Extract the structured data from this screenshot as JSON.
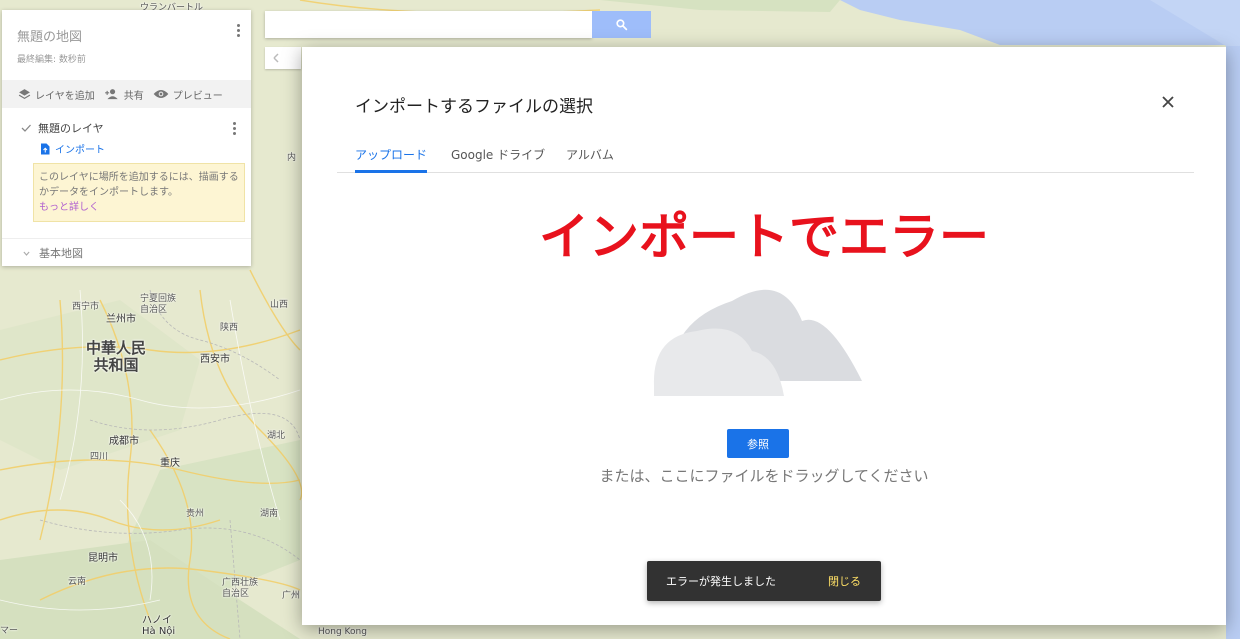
{
  "map": {
    "labels": {
      "ulaanbaatar": "ウランバートル",
      "inner": "内",
      "ningxia": "宁夏回族\n自治区",
      "xining": "西宁市",
      "lanzhou": "兰州市",
      "shanxi": "山西",
      "shaanxi": "陕西",
      "china": "中華人民\n共和国",
      "xian": "西安市",
      "hubei": "湖北",
      "chengdu": "成都市",
      "sichuan": "四川",
      "chongqing": "重庆",
      "guizhou": "贵州",
      "hunan": "湖南",
      "kunming": "昆明市",
      "yunnan": "云南",
      "guangxi": "广西壮族\n自治区",
      "guangdong": "广州",
      "hanoi": "ハノイ\nHà Nội",
      "hongkong": "Hong Kong",
      "edge": "マー"
    }
  },
  "search": {
    "button_icon": "search-icon"
  },
  "panel": {
    "title": "無題の地図",
    "subtitle": "最終編集: 数秒前",
    "actions": {
      "add_layer": "レイヤを追加",
      "share": "共有",
      "preview": "プレビュー"
    },
    "layer": {
      "name": "無題のレイヤ",
      "import": "インポート",
      "hint": "このレイヤに場所を追加するには、描画するかデータをインポートします。",
      "learn_more": "もっと詳しく"
    },
    "base_map": "基本地図"
  },
  "dialog": {
    "title": "インポートするファイルの選択",
    "tabs": [
      {
        "label": "アップロード",
        "active": true
      },
      {
        "label": "Google ドライブ",
        "active": false
      },
      {
        "label": "アルバム",
        "active": false
      }
    ],
    "overlay_text": "インポートでエラー",
    "browse_label": "参照",
    "drag_text": "または、ここにファイルをドラッグしてください"
  },
  "snackbar": {
    "message": "エラーが発生しました",
    "action": "閉じる"
  },
  "colors": {
    "accent": "#1a73e8",
    "error_banner": "#e8121d",
    "snackbar_bg": "#323232",
    "snackbar_action": "#ffe066",
    "search_btn": "#9ebdfa"
  }
}
